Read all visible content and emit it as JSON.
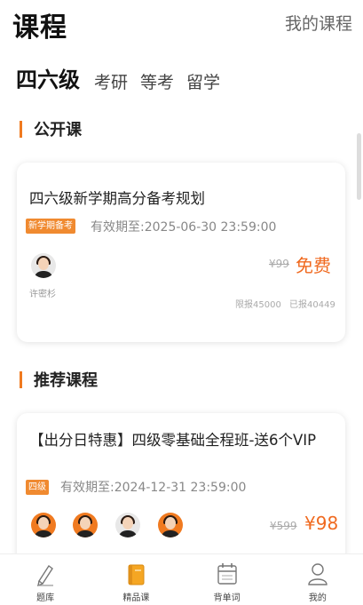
{
  "header": {
    "title": "课程",
    "my_courses": "我的课程"
  },
  "categories": [
    {
      "label": "四六级",
      "active": true
    },
    {
      "label": "考研",
      "active": false
    },
    {
      "label": "等考",
      "active": false
    },
    {
      "label": "留学",
      "active": false
    }
  ],
  "sections": {
    "public": {
      "title": "公开课"
    },
    "recommended": {
      "title": "推荐课程"
    }
  },
  "public_course": {
    "title": "四六级新学期高分备考规划",
    "tag": "新学期备考",
    "validity": "有效期至:2025-06-30 23:59:00",
    "teachers": [
      "许密杉"
    ],
    "original_price": "¥99",
    "price": "免费",
    "limit": "限报45000",
    "enrolled": "已报40449"
  },
  "recommended_course": {
    "title": "【出分日特惠】四级零基础全程班-送6个VIP",
    "tag": "四级",
    "validity": "有效期至:2024-12-31 23:59:00",
    "original_price": "¥599",
    "price": "¥98"
  },
  "bottom_nav": [
    {
      "label": "题库",
      "icon": "pencil-icon"
    },
    {
      "label": "精品课",
      "icon": "book-icon",
      "active": true
    },
    {
      "label": "背单词",
      "icon": "calendar-icon"
    },
    {
      "label": "我的",
      "icon": "user-icon"
    }
  ],
  "colors": {
    "accent": "#f07a20",
    "price": "#f06a20",
    "tag": "#f08a30"
  }
}
